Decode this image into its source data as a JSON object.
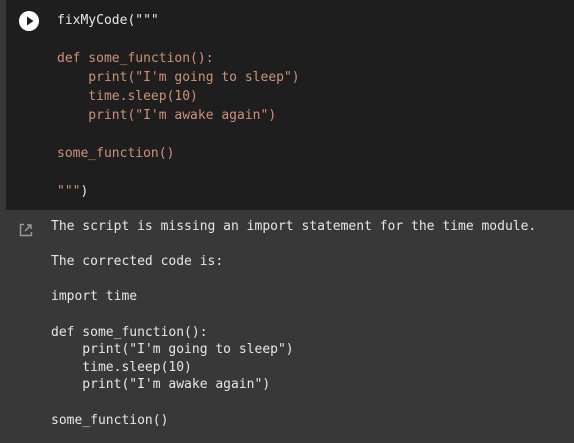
{
  "cell": {
    "run_icon": "play-icon",
    "code_lines": [
      {
        "segments": [
          {
            "text": "fixMyCode(\"\"\"",
            "cls": "tok-light"
          }
        ]
      },
      {
        "segments": [
          {
            "text": "",
            "cls": "tok-plain"
          }
        ]
      },
      {
        "segments": [
          {
            "text": "def some_function():",
            "cls": "tok-orange"
          }
        ]
      },
      {
        "segments": [
          {
            "text": "    print(\"I'm going to sleep\")",
            "cls": "tok-orange"
          }
        ]
      },
      {
        "segments": [
          {
            "text": "    time.sleep(10)",
            "cls": "tok-orange"
          }
        ]
      },
      {
        "segments": [
          {
            "text": "    print(\"I'm awake again\")",
            "cls": "tok-orange"
          }
        ]
      },
      {
        "segments": [
          {
            "text": "",
            "cls": "tok-plain"
          }
        ]
      },
      {
        "segments": [
          {
            "text": "some_function()",
            "cls": "tok-orange"
          }
        ]
      },
      {
        "segments": [
          {
            "text": "",
            "cls": "tok-plain"
          }
        ]
      },
      {
        "segments": [
          {
            "text": "\"\"\"",
            "cls": "tok-orange"
          },
          {
            "text": ")",
            "cls": "tok-light"
          }
        ]
      }
    ]
  },
  "output": {
    "icon": "output-redirect-icon",
    "lines": [
      "The script is missing an import statement for the time module.",
      "",
      "The corrected code is:",
      "",
      "import time",
      "",
      "def some_function():",
      "    print(\"I'm going to sleep\")",
      "    time.sleep(10)",
      "    print(\"I'm awake again\")",
      "",
      "some_function()"
    ]
  },
  "colors": {
    "editor_bg": "#1e1e1e",
    "output_bg": "#383838",
    "string_orange": "#ce9178",
    "text_light": "#e6e6e6"
  }
}
